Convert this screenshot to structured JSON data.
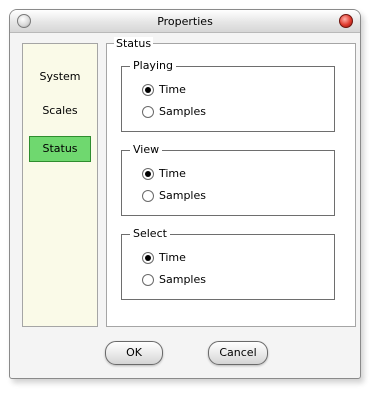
{
  "window": {
    "title": "Properties"
  },
  "sidebar": {
    "items": [
      {
        "label": "System",
        "active": false
      },
      {
        "label": "Scales",
        "active": false
      },
      {
        "label": "Status",
        "active": true
      }
    ]
  },
  "panel": {
    "title": "Status",
    "groups": [
      {
        "title": "Playing",
        "options": [
          {
            "label": "Time",
            "checked": true
          },
          {
            "label": "Samples",
            "checked": false
          }
        ]
      },
      {
        "title": "View",
        "options": [
          {
            "label": "Time",
            "checked": true
          },
          {
            "label": "Samples",
            "checked": false
          }
        ]
      },
      {
        "title": "Select",
        "options": [
          {
            "label": "Time",
            "checked": true
          },
          {
            "label": "Samples",
            "checked": false
          }
        ]
      }
    ]
  },
  "buttons": {
    "ok": "OK",
    "cancel": "Cancel"
  },
  "colors": {
    "sidebar_bg": "#fafae8",
    "active_item": "#6fd86f",
    "close_button": "#e03a2e"
  },
  "icons": {
    "minimize": "grey-round-button",
    "close": "red-round-button"
  }
}
